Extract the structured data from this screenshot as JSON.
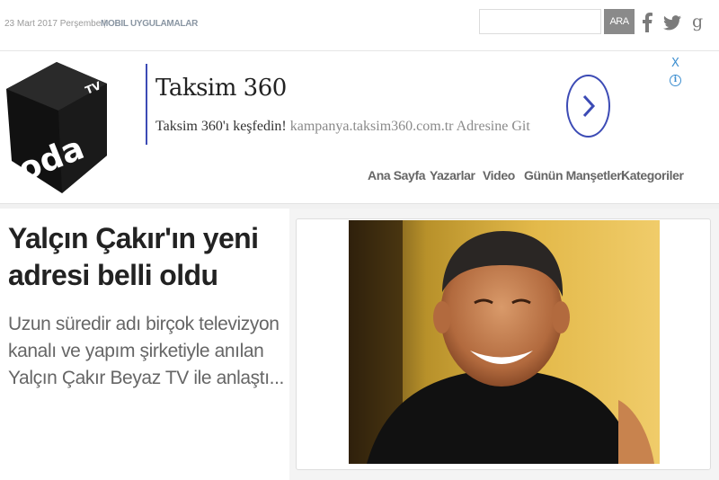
{
  "topbar": {
    "date": "23 Mart 2017 Perşembe",
    "separator": "|",
    "mobile_link": "MOBIL UYGULAMALAR",
    "search": {
      "value": "",
      "placeholder": "",
      "button": "ARA"
    },
    "social": [
      {
        "icon": "facebook-icon"
      },
      {
        "icon": "twitter-icon"
      },
      {
        "icon": "google-plus-icon"
      }
    ]
  },
  "logo": {
    "text": "oda",
    "superscript": "TV"
  },
  "ad": {
    "title": "Taksim 360",
    "description": "Taksim 360'ı keşfedin!",
    "url_text": "kampanya.taksim360.com.tr Adresine Git",
    "close": "X",
    "info": "i",
    "accent_color": "#3c4bb5"
  },
  "nav": {
    "items": [
      "Ana Sayfa",
      "Yazarlar",
      "Video",
      "Günün Manşetleri",
      "Kategoriler"
    ]
  },
  "article": {
    "headline": "Yalçın Çakır'ın yeni adresi belli oldu",
    "summary": "Uzun süredir adı birçok televizyon kanalı ve yapım şirketiyle anılan Yalçın Çakır Beyaz TV ile anlaştı..."
  }
}
